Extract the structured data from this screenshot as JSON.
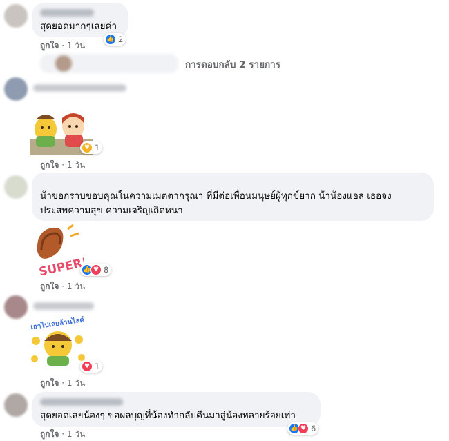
{
  "comments": [
    {
      "text": "สุดยอดมากๆเลยค่า",
      "like_label": "ถูกใจ",
      "time": "1 วัน",
      "reaction_count": "2"
    },
    {
      "text": "",
      "like_label": "ถูกใจ",
      "time": "1 วัน",
      "reaction_count": "1"
    },
    {
      "text_line1": "น้าขอกราบขอบคุณในความเมตตากรุณา ที่มีต่อเพื่อนมนุษย์ผู้ทุกข์ยาก น้าน้องแอล เธอจง",
      "text_line2": "ประสพความสุข ความเจริญเถิดหนา",
      "like_label": "ถูกใจ",
      "time": "1 วัน",
      "reaction_count": "8"
    },
    {
      "text": "",
      "like_label": "ถูกใจ",
      "time": "1 วัน",
      "reaction_count": "1"
    },
    {
      "text": "สุดยอดเลยน้องๆ ขอผลบุญที่น้องทำกลับคืนมาสู่น้องหลายร้อยเท่า",
      "like_label": "ถูกใจ",
      "time": "1 วัน",
      "reaction_count": "6"
    }
  ],
  "replies_link": "การตอบกลับ 2 รายการ",
  "meta_separator": "·",
  "stickers": {
    "super_text": "SUPER!",
    "sticker4_text": "เอาไปเลยล้านไลค์"
  },
  "colors": {
    "like": "#1877f2",
    "love": "#f33e58",
    "care": "#f7b125",
    "bubble": "#f0f2f5",
    "meta": "#65676b"
  }
}
